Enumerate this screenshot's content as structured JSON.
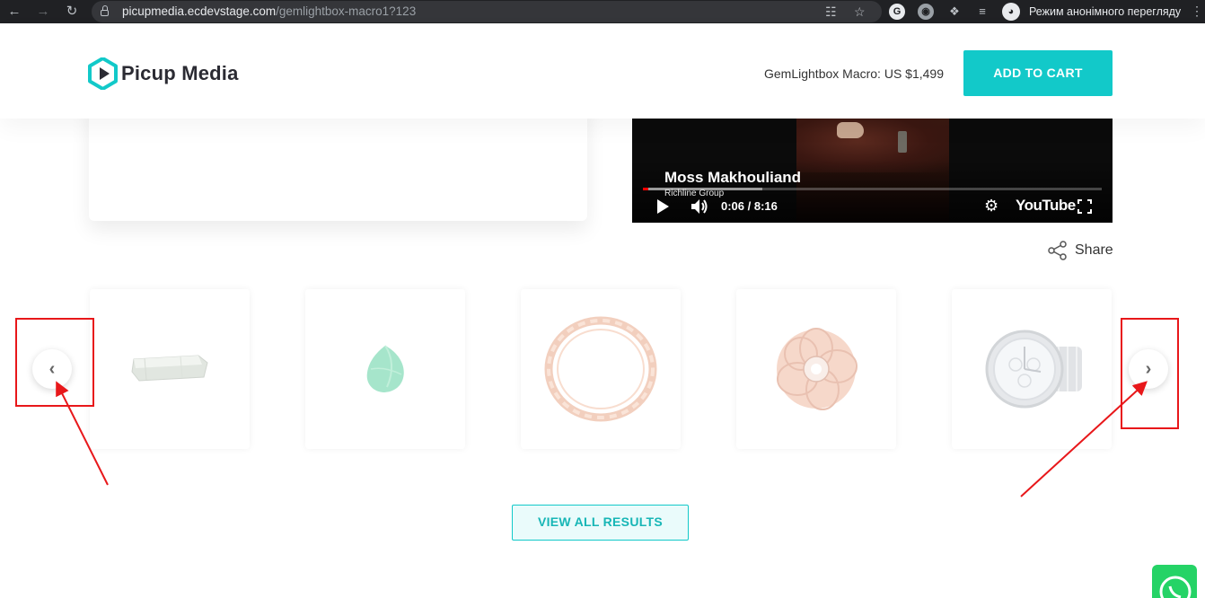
{
  "browser": {
    "url_domain": "picupmedia.ecdevstage.com",
    "url_path": "/gemlightbox-macro1?123",
    "incognito_label": "Режим анонімного перегляду"
  },
  "header": {
    "logo_text": "Picup Media",
    "price_text": "GemLightbox Macro: US $1,499",
    "add_to_cart_label": "ADD TO CART",
    "accent_color": "#12c9c9"
  },
  "video": {
    "speaker_name": "Moss Makhouliand",
    "speaker_org": "Richline Group",
    "time_display": "0:06 / 8:16",
    "youtube_label": "YouTube",
    "played_fraction": 0.012,
    "buffered_fraction": 0.26
  },
  "share": {
    "label": "Share"
  },
  "carousel": {
    "items": [
      {
        "name": "tourmaline-crystal"
      },
      {
        "name": "emerald-gem"
      },
      {
        "name": "gold-link-ring"
      },
      {
        "name": "diamond-flower-ring"
      },
      {
        "name": "diamond-watch"
      }
    ]
  },
  "view_all_label": "VIEW ALL RESULTS"
}
